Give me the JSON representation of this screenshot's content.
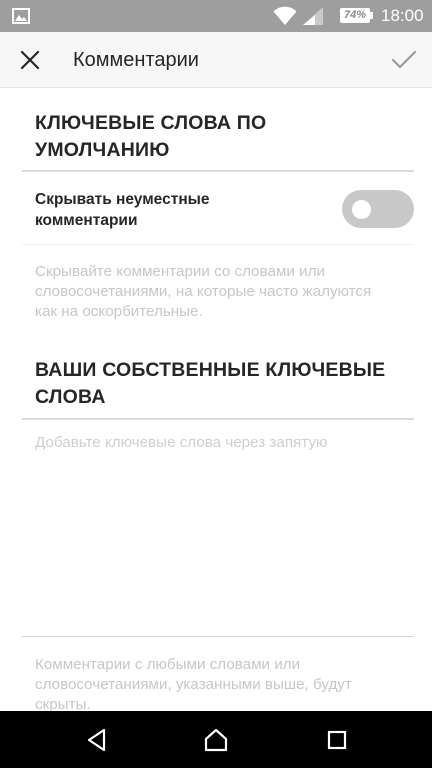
{
  "status_bar": {
    "battery": "74%",
    "time": "18:00",
    "icons": [
      "gallery-icon",
      "wifi-icon",
      "signal-icon",
      "battery-icon"
    ]
  },
  "header": {
    "title": "Комментарии",
    "close_icon": "close-icon",
    "done_icon": "checkmark-icon"
  },
  "default_keywords": {
    "title": "КЛЮЧЕВЫЕ СЛОВА ПО УМОЛЧАНИЮ",
    "toggle_label": "Скрывать неуместные комментарии",
    "toggle_on": false,
    "description": "Скрывайте комментарии со словами или словосочетаниями, на которые часто жалуются как на оскорбительные."
  },
  "custom_keywords": {
    "title": "ВАШИ СОБСТВЕННЫЕ КЛЮЧЕВЫЕ СЛОВА",
    "input_value": "",
    "input_placeholder": "Добавьте ключевые слова через запятую",
    "description": "Комментарии с любыми словами или словосочетаниями, указанными выше, будут скрыты."
  },
  "nav_bar": {
    "icons": [
      "back-icon",
      "home-icon",
      "recents-icon"
    ]
  },
  "colors": {
    "status_bar": "#9e9e9e",
    "header_bg": "#f7f7f7",
    "text": "#262626",
    "muted_text": "#c7c7c7",
    "toggle_off": "#c8c8c8",
    "nav_bar": "#000000"
  }
}
